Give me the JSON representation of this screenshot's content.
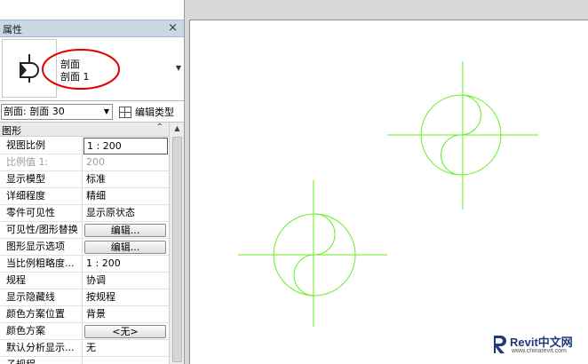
{
  "panel": {
    "title": "属性",
    "close_glyph": "×",
    "type_selector": {
      "family": "剖面",
      "type": "剖面 1"
    },
    "instance_filter": "剖面: 剖面 30",
    "edit_type_label": "编辑类型",
    "group": {
      "label": "图形",
      "collapse_glyph": "⌃"
    },
    "properties": [
      {
        "name": "视图比例",
        "value": "1 : 200",
        "style": "boxed"
      },
      {
        "name": "比例值 1:",
        "value": "200",
        "style": "gray"
      },
      {
        "name": "显示模型",
        "value": "标准",
        "style": "plain"
      },
      {
        "name": "详细程度",
        "value": "精细",
        "style": "plain"
      },
      {
        "name": "零件可见性",
        "value": "显示原状态",
        "style": "plain"
      },
      {
        "name": "可见性/图形替换",
        "value": "编辑...",
        "style": "button"
      },
      {
        "name": "图形显示选项",
        "value": "编辑...",
        "style": "button"
      },
      {
        "name": "当比例粗略度...",
        "value": "1 : 200",
        "style": "plain"
      },
      {
        "name": "规程",
        "value": "协调",
        "style": "plain"
      },
      {
        "name": "显示隐藏线",
        "value": "按规程",
        "style": "plain"
      },
      {
        "name": "颜色方案位置",
        "value": "背景",
        "style": "plain"
      },
      {
        "name": "颜色方案",
        "value": "<无>",
        "style": "button"
      },
      {
        "name": "默认分析显示...",
        "value": "无",
        "style": "plain"
      },
      {
        "name": "子规程",
        "value": "",
        "style": "plain"
      }
    ]
  },
  "watermark": {
    "brand": "Revit中文网",
    "url": "www.chinarevit.com"
  },
  "colors": {
    "symbol_green": "#66ee22",
    "annotation_red": "#e00000",
    "panel_header": "#c9d7e7",
    "watermark_blue": "#1e3a7a"
  }
}
